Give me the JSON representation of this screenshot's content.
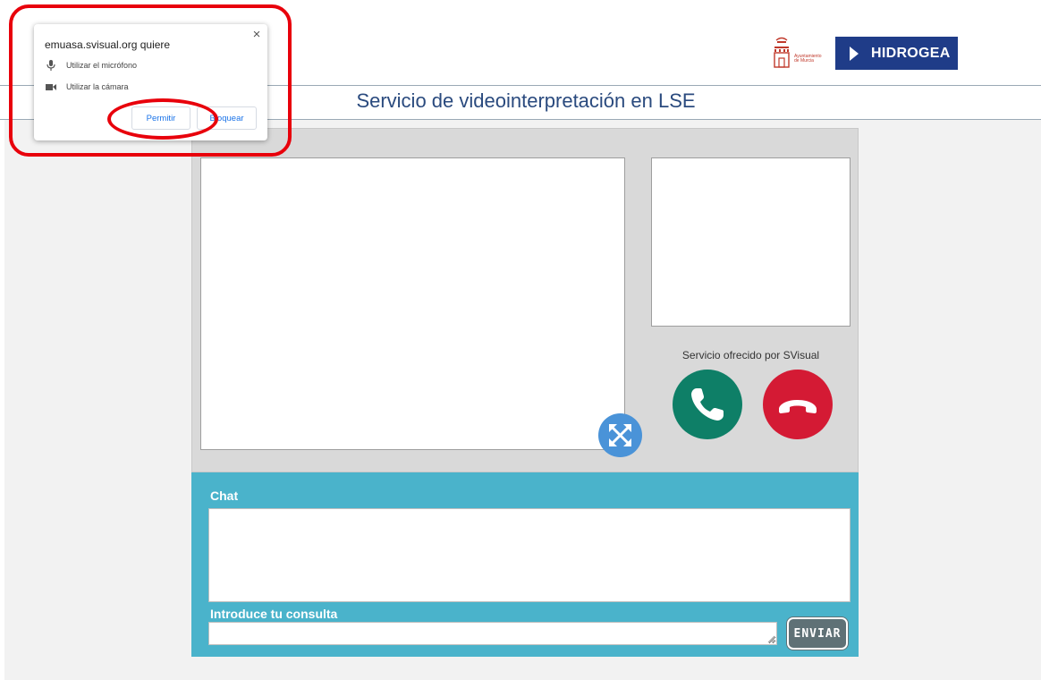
{
  "header": {
    "title": "Servicio de videointerpretación en LSE",
    "logos": {
      "murcia_text_line1": "Ayuntamiento",
      "murcia_text_line2": "de Murcia",
      "hidrogea_text": "HIDROGEA"
    }
  },
  "permission_popup": {
    "title": "emuasa.svisual.org quiere",
    "items": [
      {
        "icon": "microphone-icon",
        "label": "Utilizar el micrófono"
      },
      {
        "icon": "camera-icon",
        "label": "Utilizar la cámara"
      }
    ],
    "allow_label": "Permitir",
    "block_label": "Bloquear",
    "close_label": "×"
  },
  "video": {
    "provider_text": "Servicio ofrecido por SVisual"
  },
  "chat": {
    "title": "Chat",
    "query_label": "Introduce tu consulta",
    "query_value": "",
    "send_label": "ENVIAR"
  },
  "colors": {
    "title_blue": "#2a4a7e",
    "chat_teal": "#4ab3cb",
    "call_green": "#0e7f67",
    "hangup_red": "#d41a34",
    "expand_blue": "#4a93d8",
    "annotation_red": "#e8000b",
    "hidrogea_blue": "#1f3c88"
  }
}
